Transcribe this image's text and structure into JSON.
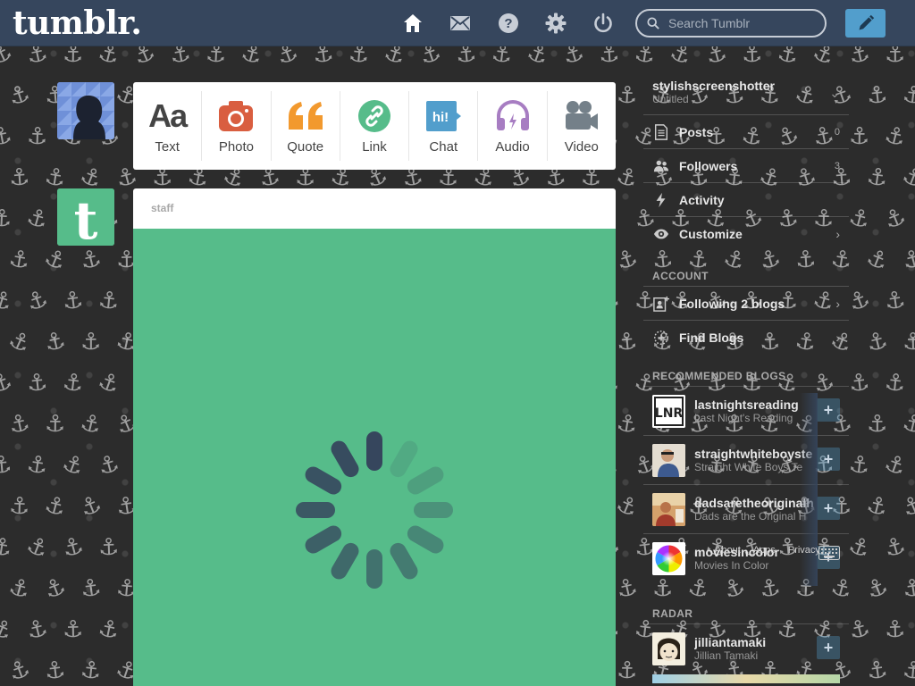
{
  "header": {
    "logo": "tumblr.",
    "search_placeholder": "Search Tumblr",
    "icons": [
      "home-icon",
      "inbox-icon",
      "help-icon",
      "settings-icon",
      "logout-icon"
    ],
    "compose_icon": "pencil-icon",
    "colors": {
      "bar": "#36465d",
      "compose": "#529ecc"
    }
  },
  "post_types": [
    {
      "label": "Text",
      "glyph": "Aa",
      "color": "#444444"
    },
    {
      "label": "Photo",
      "color": "#d95e40"
    },
    {
      "label": "Quote",
      "color": "#f2992e"
    },
    {
      "label": "Link",
      "color": "#56bc8a"
    },
    {
      "label": "Chat",
      "glyph": "hi!",
      "color": "#529ecc"
    },
    {
      "label": "Audio",
      "color": "#a77dc2"
    },
    {
      "label": "Video",
      "color": "#748089"
    }
  ],
  "post": {
    "author": "staff",
    "media_color": "#56bc8a"
  },
  "sidebar": {
    "blog_name": "stylishscreenshotter",
    "blog_title": "Untitled",
    "menu": [
      {
        "label": "Posts",
        "count": "0"
      },
      {
        "label": "Followers",
        "count": "3"
      },
      {
        "label": "Activity"
      },
      {
        "label": "Customize"
      }
    ],
    "account_title": "ACCOUNT",
    "account_menu": [
      {
        "label": "Following 2 blogs"
      },
      {
        "label": "Find Blogs"
      }
    ],
    "recommended_title": "RECOMMENDED BLOGS",
    "recommended": [
      {
        "name": "lastnightsreading",
        "subtitle": "Last Night's Reading",
        "avatar_text": "LNR"
      },
      {
        "name": "straightwhiteboyste",
        "subtitle": "Straight White Boys Te"
      },
      {
        "name": "dadsaretheoriginalh",
        "subtitle": "Dads are the Original H"
      },
      {
        "name": "moviesincolor",
        "subtitle": "Movies In Color"
      }
    ],
    "footer": {
      "about": "About",
      "apps": "Apps",
      "privacy": "Privacy"
    },
    "radar_title": "RADAR",
    "radar": {
      "name": "jilliantamaki",
      "subtitle": "Jillian Tamaki"
    }
  }
}
